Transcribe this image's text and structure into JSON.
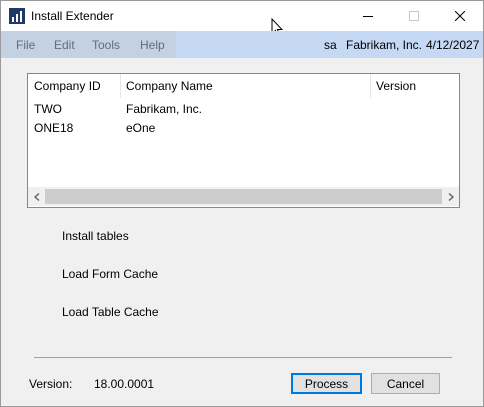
{
  "window": {
    "title": "Install Extender",
    "icon": "bar-chart-icon"
  },
  "menu": {
    "items": [
      "File",
      "Edit",
      "Tools",
      "Help"
    ]
  },
  "status": {
    "user": "sa",
    "company": "Fabrikam, Inc.",
    "date": "4/12/2027"
  },
  "list": {
    "columns": [
      "Company ID",
      "Company Name",
      "Version"
    ],
    "rows": [
      {
        "id": "TWO",
        "name": "Fabrikam, Inc.",
        "version": ""
      },
      {
        "id": "ONE18",
        "name": "eOne",
        "version": ""
      }
    ]
  },
  "steps": [
    "Install tables",
    "Load Form Cache",
    "Load Table Cache"
  ],
  "footer": {
    "version_label": "Version:",
    "version_value": "18.00.0001",
    "process_label": "Process",
    "cancel_label": "Cancel"
  },
  "colors": {
    "menu_bar": "#c3d1e2",
    "status_bar": "#c5d8f4",
    "default_button_border": "#0078d7"
  }
}
